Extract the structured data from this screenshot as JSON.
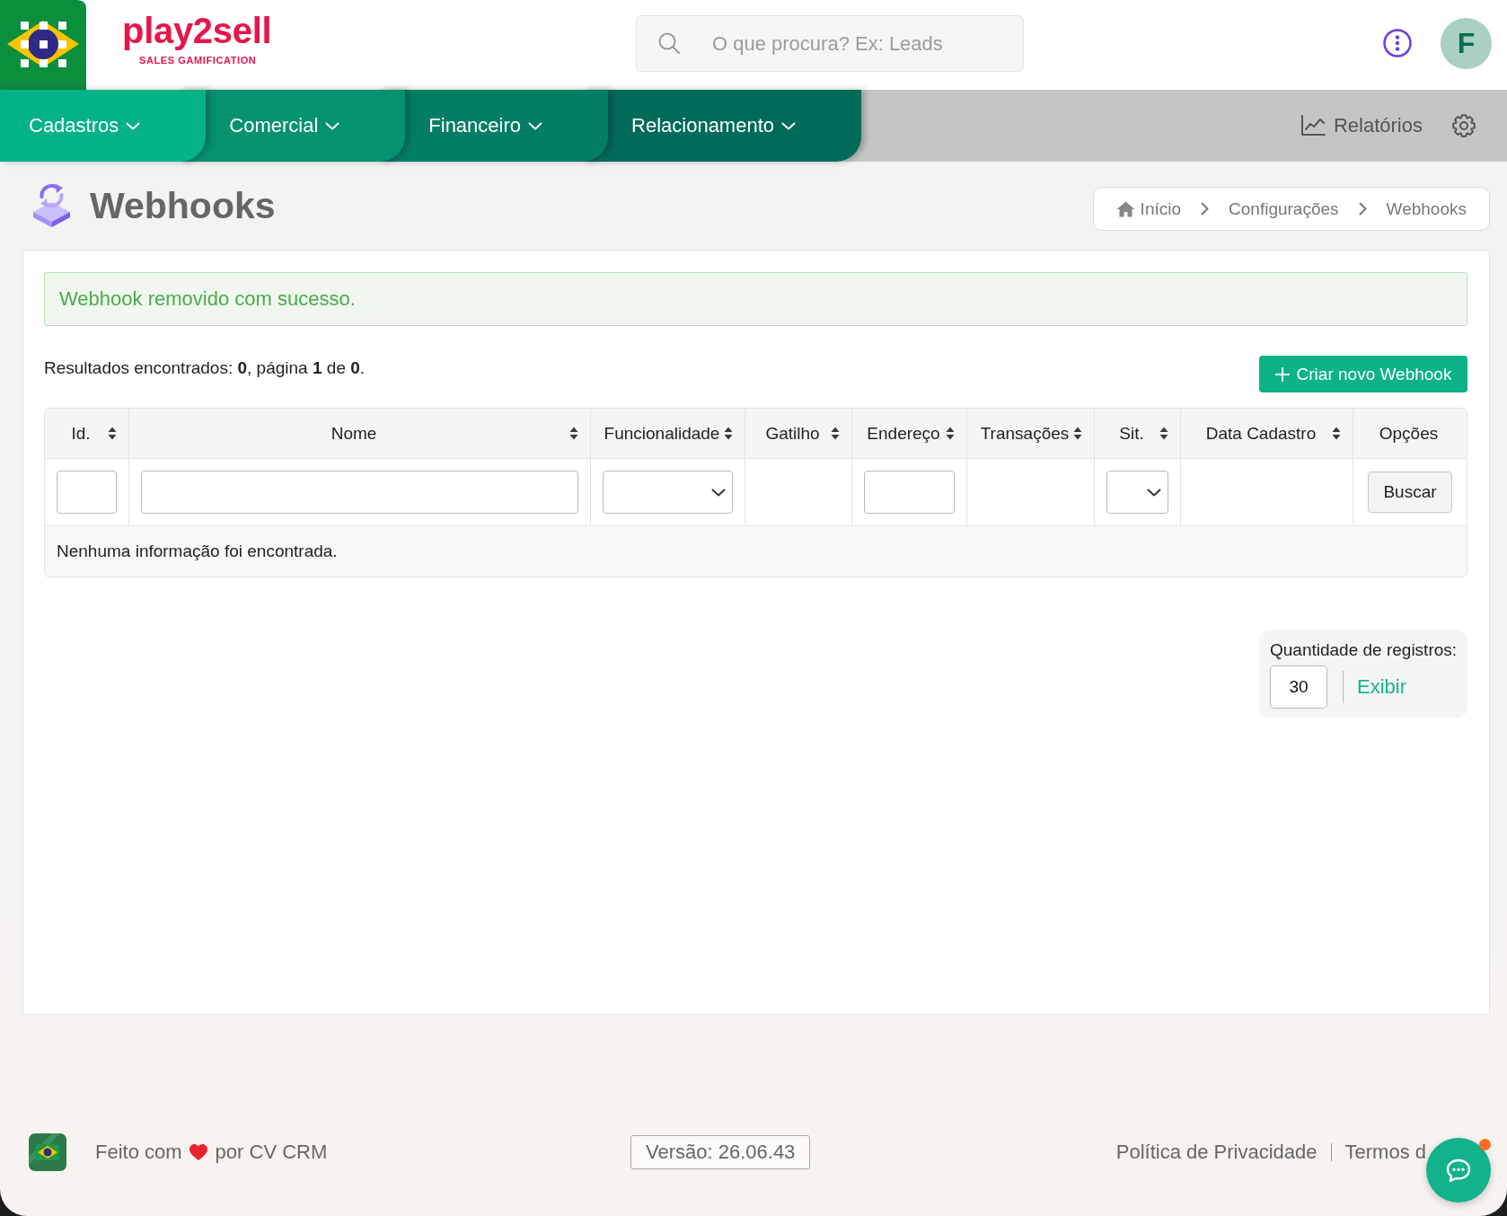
{
  "header": {
    "logo": {
      "wordmark": "play2sell",
      "tagline": "SALES GAMIFICATION"
    },
    "search": {
      "placeholder": "O que procura? Ex: Leads"
    },
    "user": {
      "initial": "F"
    }
  },
  "nav": {
    "items": [
      {
        "label": "Cadastros"
      },
      {
        "label": "Comercial"
      },
      {
        "label": "Financeiro"
      },
      {
        "label": "Relacionamento"
      }
    ],
    "reports": {
      "label": "Relatórios"
    }
  },
  "page": {
    "title": "Webhooks",
    "breadcrumb": [
      {
        "label": "Início",
        "kind": "home"
      },
      {
        "label": "Configurações",
        "kind": "link"
      },
      {
        "label": "Webhooks",
        "kind": "link"
      }
    ]
  },
  "alert": {
    "kind": "success",
    "message": "Webhook removido com sucesso."
  },
  "results": {
    "summary": "Resultados encontrados: **0**, página **1** de **0**.",
    "create_button": "Criar novo Webhook"
  },
  "table": {
    "columns": [
      {
        "label": "Id.",
        "sortable": true,
        "filter": {
          "kind": "input"
        }
      },
      {
        "label": "Nome",
        "sortable": true,
        "filter": {
          "kind": "input"
        }
      },
      {
        "label": "Funcionalidade",
        "sortable": true,
        "filter": {
          "kind": "select"
        }
      },
      {
        "label": "Gatilho",
        "sortable": true
      },
      {
        "label": "Endereço",
        "sortable": true,
        "filter": {
          "kind": "input"
        }
      },
      {
        "label": "Transações",
        "sortable": true
      },
      {
        "label": "Sit.",
        "sortable": true,
        "filter": {
          "kind": "select"
        }
      },
      {
        "label": "Data Cadastro",
        "sortable": true
      },
      {
        "label": "Opções",
        "sortable": false,
        "filter": {
          "kind": "button",
          "label": "Buscar"
        }
      }
    ],
    "empty_message": "Nenhuma informação foi encontrada."
  },
  "page_size": {
    "label": "Quantidade de registros:",
    "value": "30",
    "action": "Exibir"
  },
  "footer": {
    "made_with": "Feito com",
    "made_by": "por CV CRM",
    "version": "Versão: 26.06.43",
    "links": [
      "Política de Privacidade",
      "Termos d"
    ]
  },
  "chat": {
    "unread": true
  }
}
